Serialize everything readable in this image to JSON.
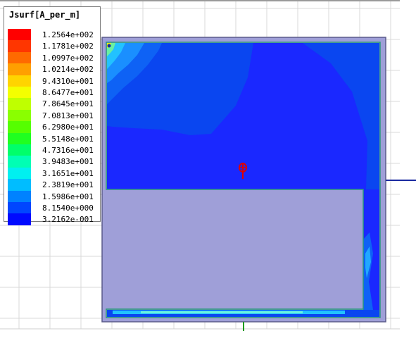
{
  "legend": {
    "title": "Jsurf[A_per_m]",
    "entries": [
      {
        "value": "1.2564e+002",
        "color": "#ff0000"
      },
      {
        "value": "1.1781e+002",
        "color": "#ff3600"
      },
      {
        "value": "1.0997e+002",
        "color": "#ff6a00"
      },
      {
        "value": "1.0214e+002",
        "color": "#ff9f00"
      },
      {
        "value": "9.4310e+001",
        "color": "#ffd400"
      },
      {
        "value": "8.6477e+001",
        "color": "#f4ff00"
      },
      {
        "value": "7.8645e+001",
        "color": "#bfff00"
      },
      {
        "value": "7.0813e+001",
        "color": "#8aff00"
      },
      {
        "value": "6.2980e+001",
        "color": "#55ff00"
      },
      {
        "value": "5.5148e+001",
        "color": "#20ff20"
      },
      {
        "value": "4.7316e+001",
        "color": "#00ff6a"
      },
      {
        "value": "3.9483e+001",
        "color": "#00ffb4"
      },
      {
        "value": "3.1651e+001",
        "color": "#00f0f0"
      },
      {
        "value": "2.3819e+001",
        "color": "#00bdff"
      },
      {
        "value": "1.5986e+001",
        "color": "#0082ff"
      },
      {
        "value": "8.1540e+000",
        "color": "#0046ff"
      },
      {
        "value": "3.2162e-001",
        "color": "#000aff"
      }
    ]
  },
  "colors": {
    "grid": "#d9d9d9",
    "plate": "#9f9fd8",
    "plate_edge": "#5a5a8a",
    "outline": "#2a9a7a",
    "field_base": "#1a28ff",
    "axis_blue": "#1a2aa0",
    "axis_green": "#1a9a1a",
    "port_red": "#e00000"
  }
}
